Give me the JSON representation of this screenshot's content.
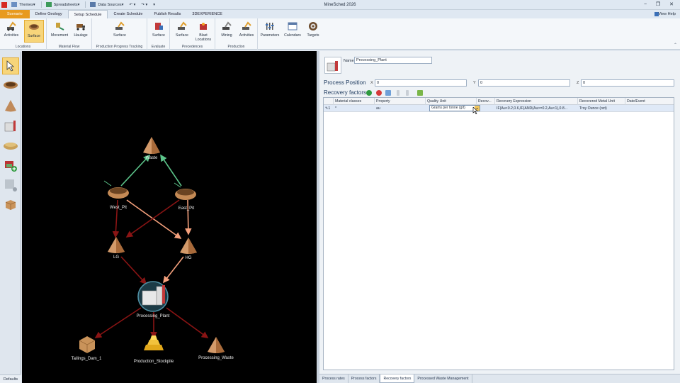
{
  "titlebar": {
    "app_title": "MineSched 2026",
    "quick_access": [
      "Themes",
      "Spreadsheets",
      "Data Sources"
    ],
    "controls": [
      "−",
      "❐",
      "✕"
    ]
  },
  "ribbon_tabs": [
    "Scenario",
    "Define Geology",
    "Setup Schedule",
    "Create Schedule",
    "Publish Results",
    "3DEXPERIENCE"
  ],
  "view_help": "View Help",
  "ribbon": {
    "groups": [
      {
        "label": "Locations",
        "buttons": [
          "Activities",
          "Surface"
        ]
      },
      {
        "label": "Material Flow",
        "buttons": [
          "Movement",
          "Haulage"
        ]
      },
      {
        "label": "Production Progress Tracking",
        "buttons": [
          "Surface"
        ]
      },
      {
        "label": "Evaluate",
        "buttons": [
          "Surface"
        ]
      },
      {
        "label": "Precedences",
        "buttons": [
          "Surface",
          "Blast\nLocations"
        ]
      },
      {
        "label": "Production",
        "buttons": [
          "Mining",
          "Activities"
        ]
      },
      {
        "label": "",
        "buttons": [
          "Parameters",
          "Calendars",
          "Targets"
        ]
      }
    ]
  },
  "toolbox": {
    "defaults_label": "Defaults"
  },
  "canvas": {
    "nodes": [
      "Waste",
      "West_Pit",
      "East_Pit",
      "LG",
      "HG",
      "Processing_Plant",
      "Tailings_Dam_1",
      "Production_Stockpile",
      "Processing_Waste"
    ]
  },
  "details": {
    "name_label": "Name",
    "name_value": "Processing_Plant",
    "process_position_title": "Process Position",
    "x_label": "X",
    "x_value": "0",
    "y_label": "Y",
    "y_value": "0",
    "z_label": "Z",
    "z_value": "0",
    "recovery_factors_title": "Recovery factors",
    "grid": {
      "columns": [
        "",
        "Material classes",
        "Property",
        "Quality Unit",
        "Recov...",
        "Recovery Expression",
        "Recovered Metal Unit",
        "Date/Event"
      ],
      "row": {
        "index": "1",
        "material_classes": "*",
        "property": "au",
        "quality_unit": "Grams per tonne (g/t)",
        "recovery": "",
        "recovery_expression": "IF(Au<0.2,0.6,IF(AND(Au>=0.2,Au<1),0.8...",
        "recovered_metal_unit": "Troy Ounce (ozt)",
        "date_event": ""
      }
    }
  },
  "bottom_tabs": [
    "Process rates",
    "Process factors",
    "Recovery factors",
    "Processed Waste Management"
  ],
  "colors": {
    "file_tab": "#e89a1e",
    "selected": "#f7d57a",
    "arrow_green": "#5cc48a",
    "arrow_pink": "#f4a07c",
    "arrow_dark": "#7a1010"
  }
}
